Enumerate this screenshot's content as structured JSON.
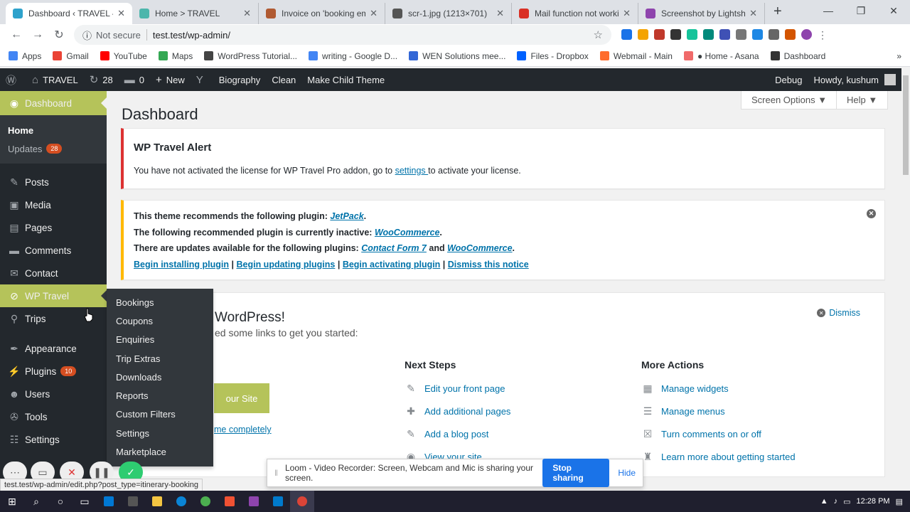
{
  "browser": {
    "tabs": [
      {
        "title": "Dashboard ‹ TRAVEL —",
        "color": "#2ea2cc",
        "active": true
      },
      {
        "title": "Home > TRAVEL",
        "color": "#4db6ac",
        "active": false
      },
      {
        "title": "Invoice on 'booking em",
        "color": "#b05a32",
        "active": false
      },
      {
        "title": "scr-1.jpg (1213×701)",
        "color": "#555555",
        "active": false
      },
      {
        "title": "Mail function not worki",
        "color": "#d93025",
        "active": false
      },
      {
        "title": "Screenshot by Lightsho",
        "color": "#8e44ad",
        "active": false
      }
    ],
    "not_secure": "Not secure",
    "url": "test.test/wp-admin/",
    "bookmarks": [
      {
        "label": "Apps",
        "color": "#4285f4"
      },
      {
        "label": "Gmail",
        "color": "#ea4335"
      },
      {
        "label": "YouTube",
        "color": "#ff0000"
      },
      {
        "label": "Maps",
        "color": "#34a853"
      },
      {
        "label": "WordPress Tutorial...",
        "color": "#444444"
      },
      {
        "label": "writing - Google D...",
        "color": "#4285f4"
      },
      {
        "label": "WEN Solutions mee...",
        "color": "#3367d6"
      },
      {
        "label": "Files - Dropbox",
        "color": "#0061ff"
      },
      {
        "label": "Webmail - Main",
        "color": "#ff6c2c"
      },
      {
        "label": "● Home - Asana",
        "color": "#f06a6a"
      },
      {
        "label": "Dashboard",
        "color": "#333333"
      }
    ]
  },
  "adminbar": {
    "site": "TRAVEL",
    "updates": "28",
    "comments": "0",
    "new": "New",
    "biography": "Biography",
    "clean": "Clean",
    "child_theme": "Make Child Theme",
    "debug": "Debug",
    "howdy": "Howdy, kushum"
  },
  "sidebar": {
    "dashboard": "Dashboard",
    "home": "Home",
    "updates": "Updates",
    "updates_count": "28",
    "posts": "Posts",
    "media": "Media",
    "pages": "Pages",
    "comments": "Comments",
    "contact": "Contact",
    "wp_travel": "WP Travel",
    "trips": "Trips",
    "appearance": "Appearance",
    "plugins": "Plugins",
    "plugins_count": "10",
    "users": "Users",
    "tools": "Tools",
    "settings": "Settings"
  },
  "flyout": [
    "Bookings",
    "Coupons",
    "Enquiries",
    "Trip Extras",
    "Downloads",
    "Reports",
    "Custom Filters",
    "Settings",
    "Marketplace"
  ],
  "main": {
    "title": "Dashboard",
    "screen_options": "Screen Options ▼",
    "help": "Help ▼",
    "alert_title": "WP Travel Alert",
    "alert_text_1": "You have not activated the license for WP Travel Pro addon, go to ",
    "alert_link": "settings ",
    "alert_text_2": "to activate your license.",
    "n2_l1a": "This theme recommends the following plugin: ",
    "n2_l1b": "JetPack",
    "n2_l2a": "The following recommended plugin is currently inactive: ",
    "n2_l2b": "WooCommerce",
    "n2_l3a": "There are updates available for the following plugins: ",
    "n2_l3b": "Contact Form 7",
    "n2_l3c": " and ",
    "n2_l3d": "WooCommerce",
    "link_install": "Begin installing plugin",
    "link_update": "Begin updating plugins",
    "link_activate": "Begin activating plugin",
    "link_dismiss": "Dismiss this notice",
    "welcome_title": "WordPress!",
    "welcome_sub": "ed some links to get you started:",
    "dismiss": "Dismiss",
    "cta": "our Site",
    "or_link": "me completely",
    "next_steps": "Next Steps",
    "next_items": [
      "Edit your front page",
      "Add additional pages",
      "Add a blog post",
      "View your site"
    ],
    "more_actions": "More Actions",
    "more_items": [
      "Manage widgets",
      "Manage menus",
      "Turn comments on or off",
      "Learn more about getting started"
    ]
  },
  "loom": {
    "text": "Loom - Video Recorder: Screen, Webcam and Mic is sharing your screen.",
    "stop": "Stop sharing",
    "hide": "Hide"
  },
  "statusbar": "test.test/wp-admin/edit.php?post_type=itinerary-booking",
  "taskbar": {
    "time": "12:28 PM"
  }
}
